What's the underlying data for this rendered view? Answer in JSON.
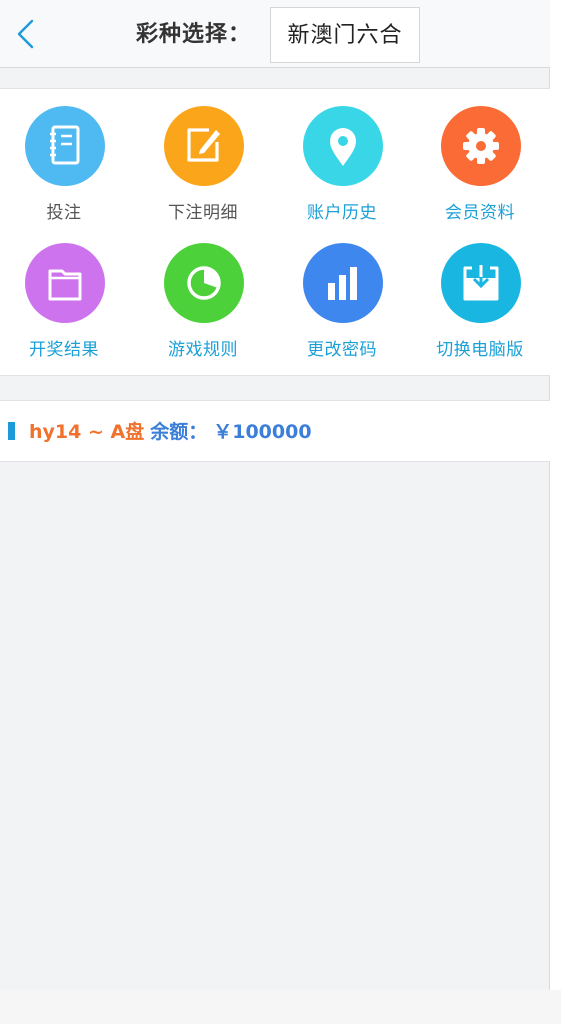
{
  "header": {
    "label": "彩种选择：",
    "lottery_value": "新澳门六合"
  },
  "menu": {
    "items": [
      {
        "label": "投注",
        "icon": "notebook-icon",
        "color": "#4fb9f2"
      },
      {
        "label": "下注明细",
        "icon": "edit-icon",
        "color": "#fba51b"
      },
      {
        "label": "账户历史",
        "icon": "location-pin-icon",
        "color": "#39d6e8"
      },
      {
        "label": "会员资料",
        "icon": "gear-icon",
        "color": "#fb6b35"
      },
      {
        "label": "开奖结果",
        "icon": "folder-icon",
        "color": "#cd73ed"
      },
      {
        "label": "游戏规则",
        "icon": "pie-chart-icon",
        "color": "#4cd13a"
      },
      {
        "label": "更改密码",
        "icon": "bar-chart-icon",
        "color": "#3e87ee"
      },
      {
        "label": "切换电脑版",
        "icon": "download-icon",
        "color": "#18b6e0"
      }
    ]
  },
  "account": {
    "user": "hy14 ~ A盘",
    "balance_label": "余额：",
    "balance_value": "￥100000"
  },
  "colors": {
    "accent_blue": "#1d9bd9",
    "user_orange": "#f0722d",
    "balance_blue": "#3c7fd8"
  }
}
